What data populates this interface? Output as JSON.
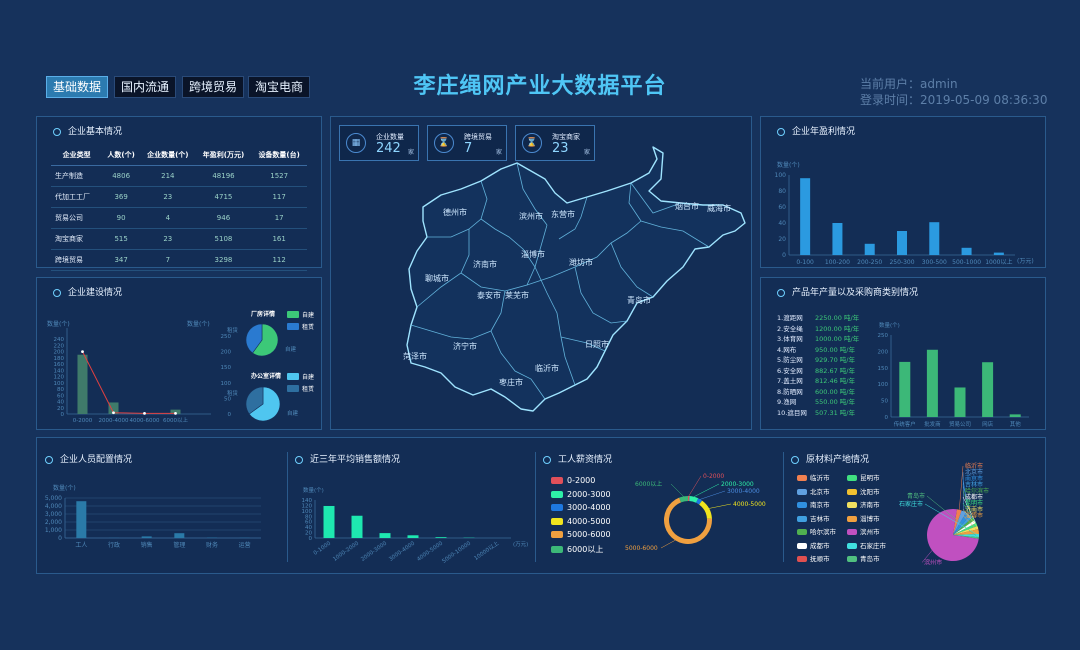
{
  "nav": {
    "tabs": [
      "基础数据",
      "国内流通",
      "跨境贸易",
      "淘宝电商"
    ]
  },
  "header": {
    "title": "李庄绳网产业大数据平台",
    "user": "当前用户：admin",
    "login_time": "登录时间：2019-05-09 08:36:30"
  },
  "basic_info": {
    "title": "企业基本情况",
    "columns": [
      "企业类型",
      "人数(个)",
      "企业数量(个)",
      "年盈利(万元)",
      "设备数量(台)"
    ],
    "rows": [
      [
        "生产制造",
        "4806",
        "214",
        "48196",
        "1527"
      ],
      [
        "代加工工厂",
        "369",
        "23",
        "4715",
        "117"
      ],
      [
        "贸易公司",
        "90",
        "4",
        "946",
        "17"
      ],
      [
        "淘宝商家",
        "515",
        "23",
        "5108",
        "161"
      ],
      [
        "跨境贸易",
        "347",
        "7",
        "3298",
        "112"
      ]
    ]
  },
  "construction": {
    "title": "企业建设情况",
    "ylabel_left": "数量(个)",
    "ylabel_right": "数量(个)",
    "factory_title": "厂房详情",
    "office_title": "办公室详情",
    "legend_self": "自建",
    "legend_rent": "租赁",
    "pie_label_rent": "租赁",
    "pie_label_self": "自建"
  },
  "map": {
    "stats": [
      {
        "label": "企业数量",
        "value": "242",
        "unit": "家",
        "icon": "grid-icon"
      },
      {
        "label": "跨境贸易",
        "value": "7",
        "unit": "家",
        "icon": "hourglass-icon"
      },
      {
        "label": "淘宝商家",
        "value": "23",
        "unit": "家",
        "icon": "hourglass-icon"
      }
    ],
    "cities": [
      "德州市",
      "滨州市",
      "东营市",
      "烟台市",
      "威海市",
      "聊城市",
      "济南市",
      "淄博市",
      "潍坊市",
      "泰安市",
      "莱芜市",
      "青岛市",
      "济宁市",
      "菏泽市",
      "临沂市",
      "日照市",
      "枣庄市"
    ]
  },
  "profit": {
    "title": "企业年盈利情况"
  },
  "products": {
    "title": "产品年产量以及采购商类别情况",
    "ylabel": "数量(个)",
    "ranking": [
      {
        "name": "1.渡距网",
        "value": "2250.00 吨/年"
      },
      {
        "name": "2.安全绳",
        "value": "1200.00 吨/年"
      },
      {
        "name": "3.体育网",
        "value": "1000.00 吨/年"
      },
      {
        "name": "4.网布",
        "value": "950.00 吨/年"
      },
      {
        "name": "5.防尘网",
        "value": "929.70 吨/年"
      },
      {
        "name": "6.安全网",
        "value": "882.67 吨/年"
      },
      {
        "name": "7.盖土网",
        "value": "812.46 吨/年"
      },
      {
        "name": "8.防晒网",
        "value": "600.00 吨/年"
      },
      {
        "name": "9.渔网",
        "value": "550.00 吨/年"
      },
      {
        "name": "10.遮目网",
        "value": "507.31 吨/年"
      }
    ]
  },
  "staff": {
    "title": "企业人员配置情况"
  },
  "sales": {
    "title": "近三年平均销售额情况"
  },
  "salary": {
    "title": "工人薪资情况",
    "legend": [
      {
        "label": "0-2000",
        "color": "#e0505a"
      },
      {
        "label": "2000-3000",
        "color": "#2ef0a8"
      },
      {
        "label": "3000-4000",
        "color": "#1e78e0"
      },
      {
        "label": "4000-5000",
        "color": "#f0e41e"
      },
      {
        "label": "5000-6000",
        "color": "#f0a040"
      },
      {
        "label": "6000以上",
        "color": "#3cb878"
      }
    ],
    "pie_labels": [
      {
        "text": "0-2000",
        "color": "#e0505a"
      },
      {
        "text": "2000-3000",
        "color": "#2ef0a8"
      },
      {
        "text": "3000-4000",
        "color": "#4b8ce0"
      },
      {
        "text": "4000-5000",
        "color": "#f0e41e"
      },
      {
        "text": "5000-6000",
        "color": "#f0a040"
      },
      {
        "text": "6000以上",
        "color": "#3cb878"
      }
    ]
  },
  "materials": {
    "title": "原材料产地情况",
    "legend": [
      {
        "label": "临沂市",
        "color": "#f08050"
      },
      {
        "label": "昆明市",
        "color": "#40e080"
      },
      {
        "label": "北京市",
        "color": "#60a0e0"
      },
      {
        "label": "沈阳市",
        "color": "#f0c030"
      },
      {
        "label": "南京市",
        "color": "#3090e0"
      },
      {
        "label": "济南市",
        "color": "#f0e060"
      },
      {
        "label": "吉林市",
        "color": "#40a0e0"
      },
      {
        "label": "淄博市",
        "color": "#f0a040"
      },
      {
        "label": "哈尔滨市",
        "color": "#50b050"
      },
      {
        "label": "滨州市",
        "color": "#c050c0"
      },
      {
        "label": "成都市",
        "color": "#ffffff"
      },
      {
        "label": "石家庄市",
        "color": "#40e0e0"
      },
      {
        "label": "抚顺市",
        "color": "#e05050"
      },
      {
        "label": "青岛市",
        "color": "#50c080"
      }
    ],
    "pie_labels": [
      "临沂市",
      "北京市",
      "南京市",
      "吉林市",
      "哈尔滨市",
      "成都市",
      "昆明市",
      "济南市",
      "淄博市",
      "石家庄市",
      "青岛市",
      "滨州市"
    ]
  },
  "chart_data": [
    {
      "type": "bar",
      "title": "",
      "categories": [
        "0-2000",
        "2000-4000",
        "4000-6000",
        "6000以上"
      ],
      "series": [
        {
          "values": [
            190,
            37,
            2,
            14
          ]
        }
      ],
      "line": [
        200,
        4,
        2,
        2
      ],
      "ylabel": "数量(个)",
      "ylim": [
        0,
        250
      ]
    },
    {
      "type": "pie",
      "title": "厂房详情",
      "categories": [
        "自建",
        "租赁"
      ],
      "values": [
        60,
        40
      ],
      "colors": [
        "#3cc878",
        "#2a7ad0"
      ]
    },
    {
      "type": "pie",
      "title": "办公室详情",
      "categories": [
        "自建",
        "租赁"
      ],
      "values": [
        65,
        35
      ],
      "colors": [
        "#4fc6f0",
        "#2e6fa0"
      ]
    },
    {
      "type": "bar",
      "title": "",
      "categories": [
        "0-100",
        "100-200",
        "200-250",
        "250-300",
        "300-500",
        "500-1000",
        "1000以上"
      ],
      "series": [
        {
          "values": [
            96,
            40,
            14,
            30,
            41,
            9,
            3
          ]
        }
      ],
      "ylabel": "数量(个)",
      "xlabel": "(万元)",
      "ylim": [
        0,
        100
      ]
    },
    {
      "type": "bar",
      "title": "",
      "categories": [
        "传统客户",
        "批发商",
        "贸易公司",
        "网店",
        "其他"
      ],
      "series": [
        {
          "values": [
            168,
            205,
            90,
            167,
            8
          ]
        }
      ],
      "ylabel": "数量(个)",
      "ylim": [
        0,
        250
      ]
    },
    {
      "type": "bar",
      "title": "",
      "categories": [
        "工人",
        "行政",
        "销售",
        "管理",
        "财务",
        "运营"
      ],
      "series": [
        {
          "values": [
            4600,
            20,
            200,
            600,
            50,
            30
          ]
        }
      ],
      "ylabel": "数量(个)",
      "ylim": [
        0,
        5000
      ]
    },
    {
      "type": "bar",
      "title": "",
      "categories": [
        "0-1000",
        "1000-2000",
        "2000-3000",
        "3000-4000",
        "4000-5000",
        "5000-10000",
        "10000以上"
      ],
      "series": [
        {
          "values": [
            118,
            82,
            18,
            10,
            3,
            1,
            0
          ]
        }
      ],
      "ylabel": "数量(个)",
      "xlabel": "(万元)",
      "ylim": [
        0,
        140
      ]
    },
    {
      "type": "pie",
      "title": "工人薪资情况",
      "categories": [
        "0-2000",
        "2000-3000",
        "3000-4000",
        "4000-5000",
        "5000-6000",
        "6000以上"
      ],
      "values": [
        1,
        6,
        3,
        14,
        70,
        6
      ]
    },
    {
      "type": "pie",
      "title": "原材料产地情况",
      "categories": [
        "临沂市",
        "北京市",
        "南京市",
        "吉林市",
        "哈尔滨市",
        "成都市",
        "昆明市",
        "济南市",
        "淄博市",
        "石家庄市",
        "青岛市",
        "滨州市"
      ],
      "values": [
        3,
        3,
        3,
        2,
        2,
        2,
        2,
        2,
        3,
        2,
        1,
        75
      ]
    }
  ]
}
